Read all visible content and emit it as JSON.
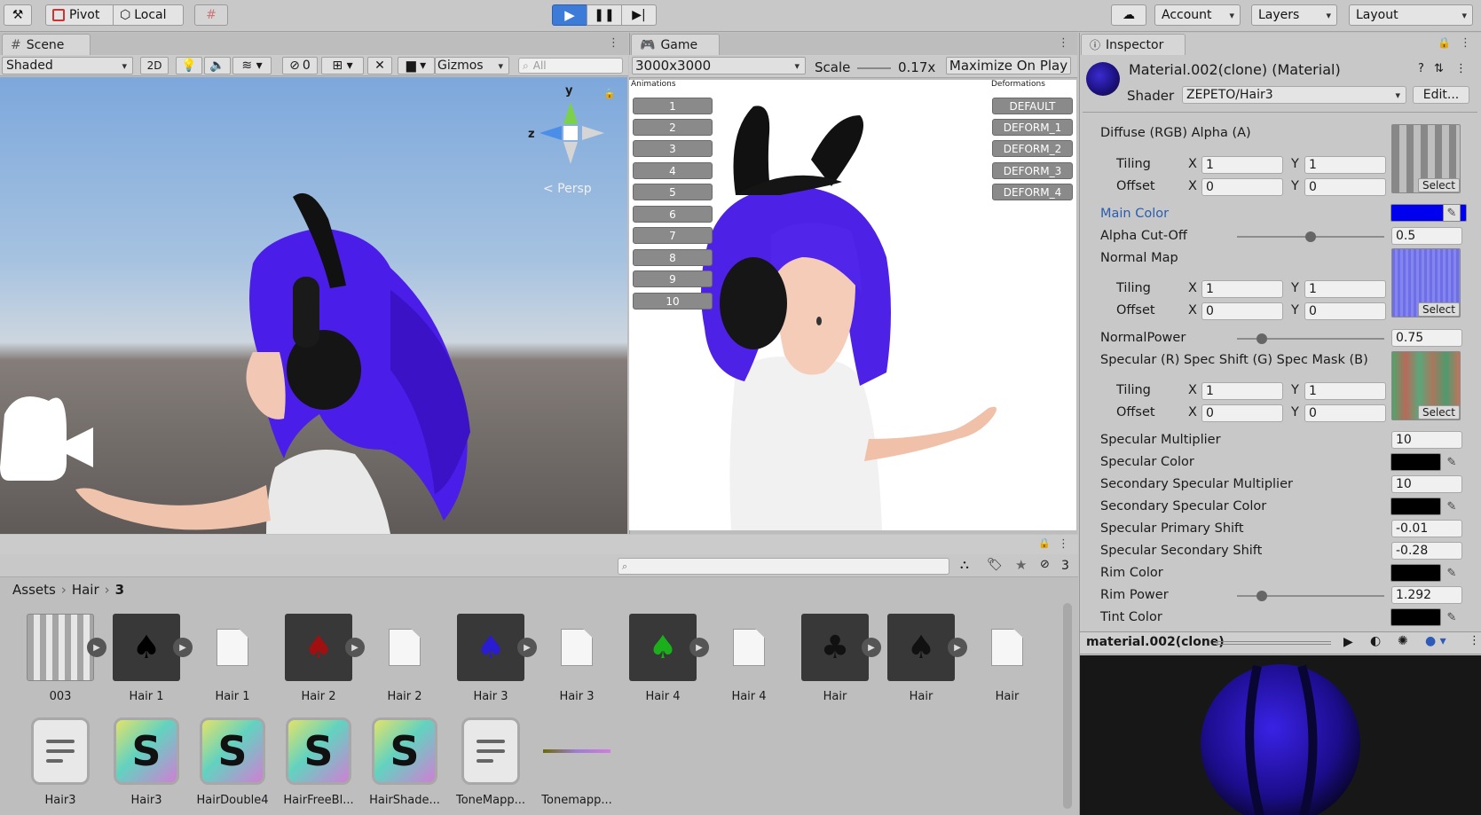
{
  "toolbar": {
    "pivot_label": "Pivot",
    "local_label": "Local",
    "account_label": "Account",
    "layers_label": "Layers",
    "layout_label": "Layout"
  },
  "scene": {
    "tab_label": "Scene",
    "shading_mode": "Shaded",
    "mode_2d": "2D",
    "hidden_count": "0",
    "gizmos_label": "Gizmos",
    "search_placeholder": "All",
    "axis_y": "y",
    "axis_z": "z",
    "persp_label": "< Persp"
  },
  "game": {
    "tab_label": "Game",
    "resolution": "3000x3000",
    "scale_label": "Scale",
    "scale_value": "0.17x",
    "maximize_label": "Maximize On Play",
    "animations_title": "Animations",
    "deformations_title": "Deformations",
    "animation_buttons": [
      "1",
      "2",
      "3",
      "4",
      "5",
      "6",
      "7",
      "8",
      "9",
      "10"
    ],
    "deform_buttons": [
      "DEFAULT",
      "DEFORM_1",
      "DEFORM_2",
      "DEFORM_3",
      "DEFORM_4"
    ]
  },
  "inspector": {
    "tab_label": "Inspector",
    "title": "Material.002(clone) (Material)",
    "shader_label": "Shader",
    "shader_value": "ZEPETO/Hair3",
    "edit_label": "Edit...",
    "select_label": "Select",
    "tiling_label": "Tiling",
    "offset_label": "Offset",
    "x_label": "X",
    "y_label": "Y",
    "diffuse_label": "Diffuse (RGB) Alpha (A)",
    "diffuse_tiling_x": "1",
    "diffuse_tiling_y": "1",
    "diffuse_offset_x": "0",
    "diffuse_offset_y": "0",
    "main_color_label": "Main Color",
    "alpha_cutoff_label": "Alpha Cut-Off",
    "alpha_cutoff_value": "0.5",
    "normal_map_label": "Normal Map",
    "normal_tiling_x": "1",
    "normal_tiling_y": "1",
    "normal_offset_x": "0",
    "normal_offset_y": "0",
    "normal_power_label": "NormalPower",
    "normal_power_value": "0.75",
    "specular_tex_label": "Specular (R) Spec Shift (G) Spec Mask (B)",
    "spec_tiling_x": "1",
    "spec_tiling_y": "1",
    "spec_offset_x": "0",
    "spec_offset_y": "0",
    "spec_mult_label": "Specular Multiplier",
    "spec_mult_value": "10",
    "spec_color_label": "Specular Color",
    "sec_spec_mult_label": "Secondary Specular Multiplier",
    "sec_spec_mult_value": "10",
    "sec_spec_color_label": "Secondary Specular Color",
    "spec_primary_shift_label": "Specular Primary Shift",
    "spec_primary_shift_value": "-0.01",
    "spec_secondary_shift_label": "Specular Secondary Shift",
    "spec_secondary_shift_value": "-0.28",
    "rim_color_label": "Rim Color",
    "rim_power_label": "Rim Power",
    "rim_power_value": "1.292",
    "tint_color_label": "Tint Color",
    "preview_name": "material.002(clone)",
    "sliders": {
      "alpha_cutoff": 0.5,
      "normal_power": 0.17,
      "rim_power": 0.17
    }
  },
  "project": {
    "breadcrumb": [
      "Assets",
      "Hair",
      "3"
    ],
    "hidden_count": "3",
    "assets_row1": [
      "003",
      "Hair 1",
      "Hair 1",
      "Hair 2",
      "Hair 2",
      "Hair 3",
      "Hair 3",
      "Hair 4",
      "Hair 4",
      "Hair",
      "Hair",
      "Hair"
    ],
    "assets_row2": [
      "Hair3",
      "Hair3",
      "HairDouble4",
      "HairFreeBl...",
      "HairShade...",
      "ToneMapp...",
      "Tonemapp..."
    ]
  },
  "colors": {
    "main_color": "#0000ee",
    "hair": "#4b1fe0",
    "active_play": "#3d7bd9"
  }
}
